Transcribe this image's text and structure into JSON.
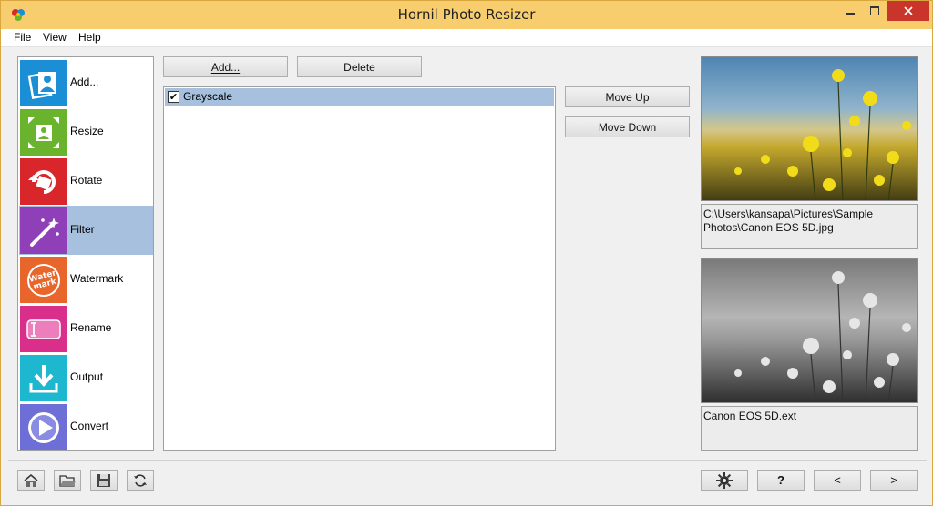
{
  "window": {
    "title": "Hornil Photo Resizer",
    "accent": "#f7cd6e",
    "close_color": "#c9352b"
  },
  "menu": [
    "File",
    "View",
    "Help"
  ],
  "sidebar": {
    "items": [
      {
        "label": "Add...",
        "icon": "photos-icon",
        "color": "#1a8fd6"
      },
      {
        "label": "Resize",
        "icon": "resize-icon",
        "color": "#6ab42d"
      },
      {
        "label": "Rotate",
        "icon": "rotate-icon",
        "color": "#d8262b"
      },
      {
        "label": "Filter",
        "icon": "magic-wand-icon",
        "color": "#8f3fb8"
      },
      {
        "label": "Watermark",
        "icon": "watermark-icon",
        "color": "#e8662b"
      },
      {
        "label": "Rename",
        "icon": "rename-icon",
        "color": "#d92f8a"
      },
      {
        "label": "Output",
        "icon": "download-icon",
        "color": "#1eb7d0"
      },
      {
        "label": "Convert",
        "icon": "play-icon",
        "color": "#6d6ed6"
      }
    ],
    "selected": "Filter"
  },
  "toolbar": {
    "add_label": "Add...",
    "delete_label": "Delete",
    "move_up_label": "Move Up",
    "move_down_label": "Move Down"
  },
  "filters": [
    {
      "label": "Grayscale",
      "checked": true
    }
  ],
  "preview": {
    "source_caption": "C:\\Users\\kansapa\\Pictures\\Sample Photos\\Canon EOS 5D.jpg",
    "output_caption": "Canon EOS 5D.ext"
  },
  "bottom": {
    "help_label": "?",
    "prev_label": "<",
    "next_label": ">"
  }
}
